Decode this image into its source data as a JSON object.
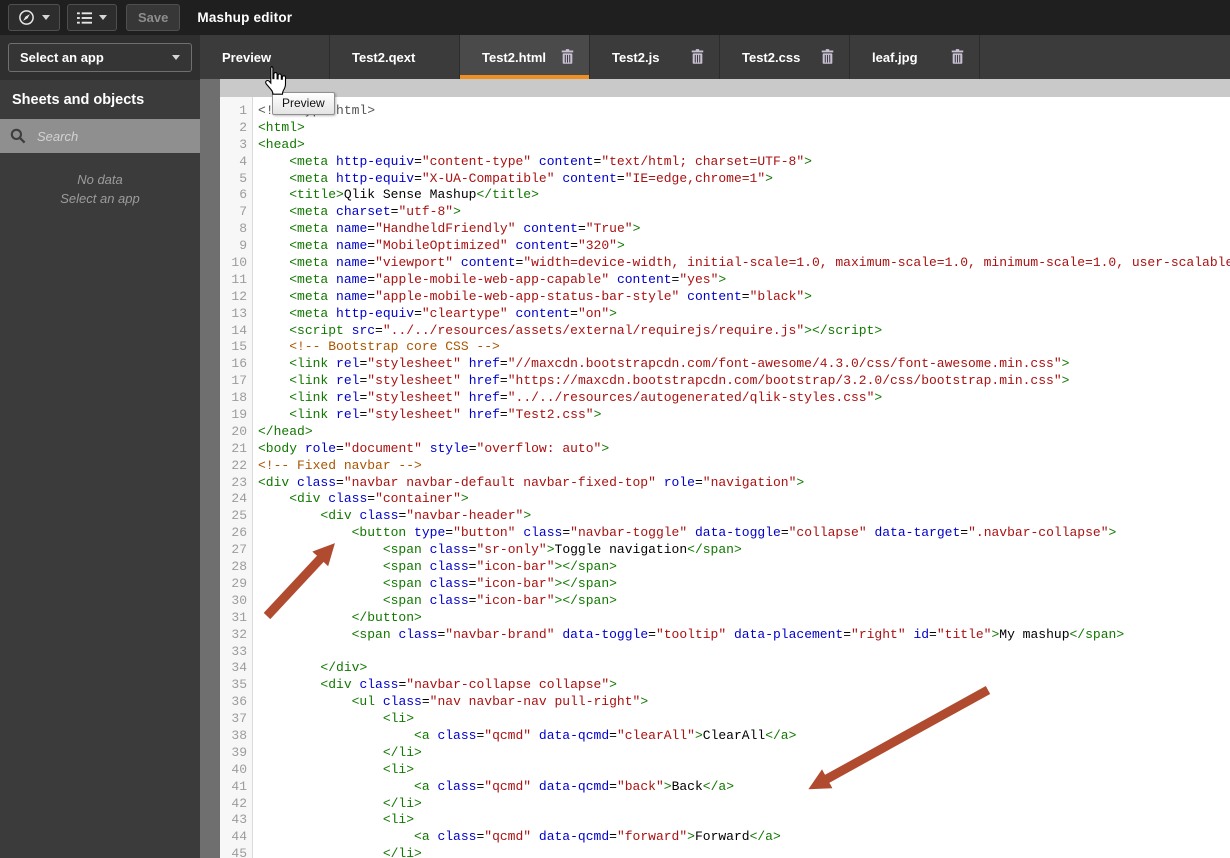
{
  "topbar": {
    "title": "Mashup editor",
    "save_label": "Save",
    "icons": {
      "app_menu": "compass-icon",
      "view_menu": "list-icon",
      "dropdown": "chevron-down-icon"
    }
  },
  "sidebar": {
    "app_selector_label": "Select an app",
    "section_title": "Sheets and objects",
    "search_placeholder": "Search",
    "search_icon": "search-icon",
    "empty_line1": "No data",
    "empty_line2": "Select an app"
  },
  "tabs": [
    {
      "label": "Preview",
      "active": false,
      "deletable": false
    },
    {
      "label": "Test2.qext",
      "active": false,
      "deletable": false
    },
    {
      "label": "Test2.html",
      "active": true,
      "deletable": true
    },
    {
      "label": "Test2.js",
      "active": false,
      "deletable": true
    },
    {
      "label": "Test2.css",
      "active": false,
      "deletable": true
    },
    {
      "label": "leaf.jpg",
      "active": false,
      "deletable": true
    }
  ],
  "cursor": {
    "tooltip": "Preview",
    "icon": "hand-cursor-icon"
  },
  "editor": {
    "language": "html",
    "lines": [
      "<!doctype html>",
      "<html>",
      "<head>",
      "    <meta http-equiv=\"content-type\" content=\"text/html; charset=UTF-8\">",
      "    <meta http-equiv=\"X-UA-Compatible\" content=\"IE=edge,chrome=1\">",
      "    <title>Qlik Sense Mashup</title>",
      "    <meta charset=\"utf-8\">",
      "    <meta name=\"HandheldFriendly\" content=\"True\">",
      "    <meta name=\"MobileOptimized\" content=\"320\">",
      "    <meta name=\"viewport\" content=\"width=device-width, initial-scale=1.0, maximum-scale=1.0, minimum-scale=1.0, user-scalable=no\">",
      "    <meta name=\"apple-mobile-web-app-capable\" content=\"yes\">",
      "    <meta name=\"apple-mobile-web-app-status-bar-style\" content=\"black\">",
      "    <meta http-equiv=\"cleartype\" content=\"on\">",
      "    <script src=\"../../resources/assets/external/requirejs/require.js\"></script>",
      "    <!-- Bootstrap core CSS -->",
      "    <link rel=\"stylesheet\" href=\"//maxcdn.bootstrapcdn.com/font-awesome/4.3.0/css/font-awesome.min.css\">",
      "    <link rel=\"stylesheet\" href=\"https://maxcdn.bootstrapcdn.com/bootstrap/3.2.0/css/bootstrap.min.css\">",
      "    <link rel=\"stylesheet\" href=\"../../resources/autogenerated/qlik-styles.css\">",
      "    <link rel=\"stylesheet\" href=\"Test2.css\">",
      "</head>",
      "<body role=\"document\" style=\"overflow: auto\">",
      "<!-- Fixed navbar -->",
      "<div class=\"navbar navbar-default navbar-fixed-top\" role=\"navigation\">",
      "    <div class=\"container\">",
      "        <div class=\"navbar-header\">",
      "            <button type=\"button\" class=\"navbar-toggle\" data-toggle=\"collapse\" data-target=\".navbar-collapse\">",
      "                <span class=\"sr-only\">Toggle navigation</span>",
      "                <span class=\"icon-bar\"></span>",
      "                <span class=\"icon-bar\"></span>",
      "                <span class=\"icon-bar\"></span>",
      "            </button>",
      "            <span class=\"navbar-brand\" data-toggle=\"tooltip\" data-placement=\"right\" id=\"title\">My mashup</span>",
      "",
      "        </div>",
      "        <div class=\"navbar-collapse collapse\">",
      "            <ul class=\"nav navbar-nav pull-right\">",
      "                <li>",
      "                    <a class=\"qcmd\" data-qcmd=\"clearAll\">ClearAll</a>",
      "                </li>",
      "                <li>",
      "                    <a class=\"qcmd\" data-qcmd=\"back\">Back</a>",
      "                </li>",
      "                <li>",
      "                    <a class=\"qcmd\" data-qcmd=\"forward\">Forward</a>",
      "                </li>"
    ]
  },
  "colors": {
    "accent_orange": "#ef8e21",
    "arrow_red": "#b04b30",
    "topbar_bg": "#1f1f1f",
    "sidebar_bg": "#3b3b3b",
    "syntax_tag": "#117700",
    "syntax_attribute": "#0000cc",
    "syntax_string": "#aa1111",
    "syntax_comment": "#aa5500",
    "syntax_meta": "#555555"
  }
}
